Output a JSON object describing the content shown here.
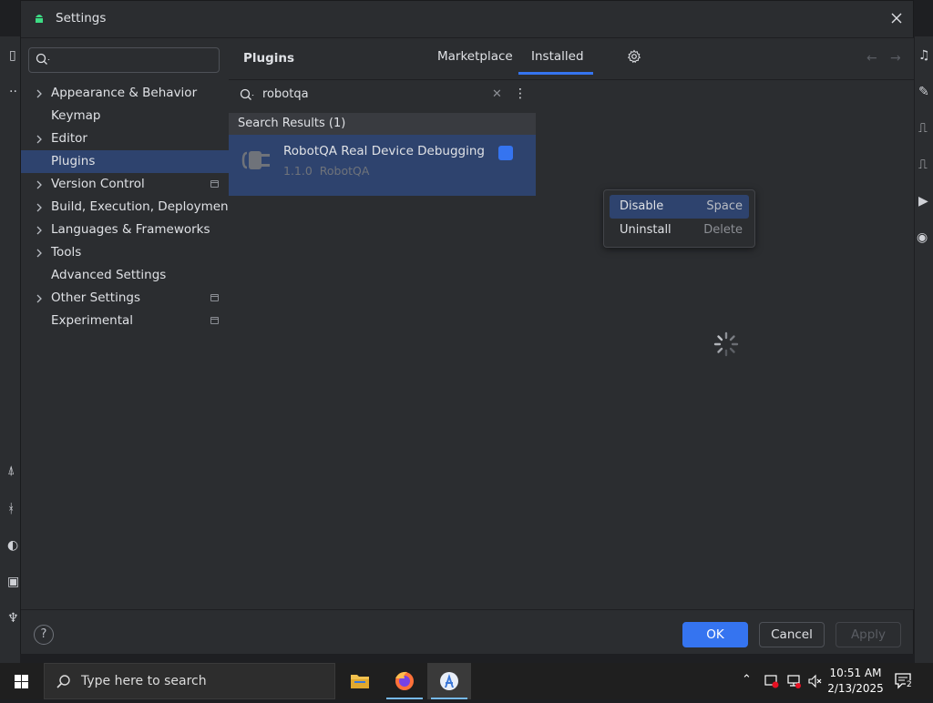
{
  "window": {
    "title": "Settings",
    "close_icon": "close-icon"
  },
  "sidebar": {
    "search_placeholder": "",
    "items": [
      {
        "label": "Appearance & Behavior",
        "expandable": true,
        "project": false
      },
      {
        "label": "Keymap",
        "expandable": false,
        "project": false
      },
      {
        "label": "Editor",
        "expandable": true,
        "project": false
      },
      {
        "label": "Plugins",
        "expandable": false,
        "project": false,
        "selected": true
      },
      {
        "label": "Version Control",
        "expandable": true,
        "project": true
      },
      {
        "label": "Build, Execution, Deployment",
        "expandable": true,
        "project": false
      },
      {
        "label": "Languages & Frameworks",
        "expandable": true,
        "project": false
      },
      {
        "label": "Tools",
        "expandable": true,
        "project": false
      },
      {
        "label": "Advanced Settings",
        "expandable": false,
        "project": false
      },
      {
        "label": "Other Settings",
        "expandable": true,
        "project": true
      },
      {
        "label": "Experimental",
        "expandable": false,
        "project": true
      }
    ]
  },
  "main": {
    "title": "Plugins",
    "tabs": [
      {
        "label": "Marketplace",
        "active": false
      },
      {
        "label": "Installed",
        "active": true
      }
    ],
    "plugin_search": {
      "query": "robotqa"
    },
    "results_header": "Search Results (1)",
    "plugin": {
      "name": "RobotQA Real Device Debugging",
      "version": "1.1.0",
      "vendor": "RobotQA",
      "enabled": true
    },
    "context_menu": [
      {
        "label": "Disable",
        "shortcut": "Space",
        "active": true
      },
      {
        "label": "Uninstall",
        "shortcut": "Delete",
        "active": false
      }
    ]
  },
  "footer": {
    "help": "?",
    "ok": "OK",
    "cancel": "Cancel",
    "apply": "Apply"
  },
  "taskbar": {
    "search_placeholder": "Type here to search",
    "time": "10:51 AM",
    "date": "2/13/2025",
    "notification_count": "2"
  },
  "colors": {
    "accent": "#3574f0",
    "selection": "#2e436e",
    "background": "#2b2d30"
  }
}
